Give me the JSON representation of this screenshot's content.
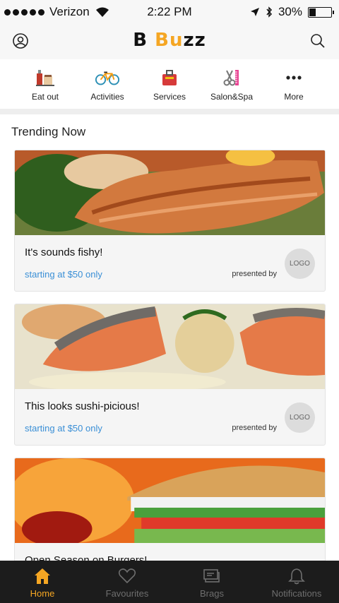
{
  "status_bar": {
    "carrier": "Verizon",
    "time": "2:22 PM",
    "battery": "30%",
    "battery_level": 0.3
  },
  "header": {
    "logo_part1": "B ",
    "logo_part2": "Bu",
    "logo_part3": "zz"
  },
  "categories": [
    {
      "label": "Eat out",
      "icon": "food-icon"
    },
    {
      "label": "Activities",
      "icon": "bicycle-icon"
    },
    {
      "label": "Services",
      "icon": "toolbox-icon"
    },
    {
      "label": "Salon&Spa",
      "icon": "scissors-comb-icon"
    },
    {
      "label": "More",
      "icon": "more-dots-icon"
    }
  ],
  "section_title": "Trending Now",
  "cards": [
    {
      "title": "It's sounds fishy!",
      "price": "starting at $50 only",
      "presented": "presented by",
      "logo": "LOGO"
    },
    {
      "title": "This looks sushi-picious!",
      "price": "starting at $50 only",
      "presented": "presented by",
      "logo": "LOGO"
    },
    {
      "title": "Open Season on Burgers!"
    }
  ],
  "tabs": [
    {
      "label": "Home",
      "icon": "home-icon",
      "active": true
    },
    {
      "label": "Favourites",
      "icon": "heart-icon"
    },
    {
      "label": "Brags",
      "icon": "tickets-icon"
    },
    {
      "label": "Notifications",
      "icon": "bell-icon"
    }
  ],
  "colors": {
    "accent": "#f5a623",
    "link": "#3a8fd6",
    "tabbar": "#1c1c1c"
  }
}
